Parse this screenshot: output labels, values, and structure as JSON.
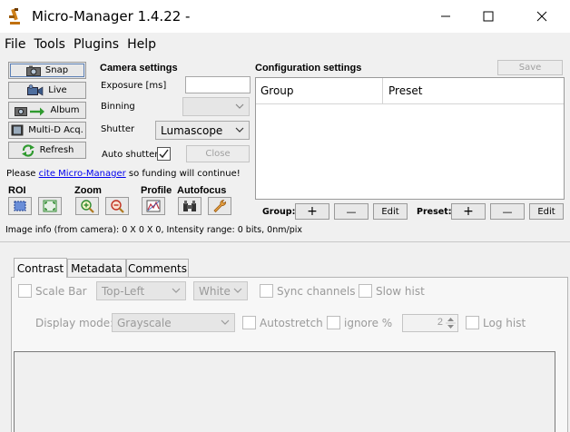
{
  "window": {
    "title": "Micro-Manager 1.4.22 -",
    "minimize_symbol": "—",
    "maximize_symbol": "☐",
    "close_symbol": "✕"
  },
  "menu": [
    "File",
    "Tools",
    "Plugins",
    "Help"
  ],
  "left_buttons": {
    "snap": "Snap",
    "live": "Live",
    "album": "Album",
    "multid": "Multi-D Acq.",
    "refresh": "Refresh"
  },
  "camera": {
    "title": "Camera settings",
    "exposure_label": "Exposure [ms]",
    "exposure_value": "",
    "binning_label": "Binning",
    "binning_value": "",
    "shutter_label": "Shutter",
    "shutter_value": "Lumascope",
    "auto_shutter_label": "Auto shutter",
    "auto_shutter_checked": true,
    "close_label": "Close"
  },
  "config": {
    "title": "Configuration settings",
    "save_label": "Save",
    "columns": [
      "Group",
      "Preset"
    ],
    "group_label": "Group:",
    "preset_label": "Preset:",
    "add_symbol": "+",
    "remove_symbol": "—",
    "edit_label": "Edit"
  },
  "cite": {
    "prefix": "Please ",
    "link": "cite Micro-Manager",
    "suffix": " so funding will continue!"
  },
  "tools": {
    "roi": "ROI",
    "zoom": "Zoom",
    "profile": "Profile",
    "autofocus": "Autofocus"
  },
  "image_info": "Image info (from camera): 0 X 0 X 0, Intensity range: 0 bits, 0nm/pix",
  "tabs": [
    "Contrast",
    "Metadata",
    "Comments"
  ],
  "contrast": {
    "scale_bar_label": "Scale Bar",
    "position_value": "Top-Left",
    "color_value": "White",
    "sync_channels_label": "Sync channels",
    "slow_hist_label": "Slow hist",
    "display_mode_label": "Display mode:",
    "display_mode_value": "Grayscale",
    "autostretch_label": "Autostretch",
    "ignore_label": "ignore %",
    "ignore_value": "2",
    "log_hist_label": "Log hist"
  },
  "colors": {
    "link": "#0000ee",
    "disabled_text": "#9a9a9a",
    "window_bg": "#f0f0f0"
  }
}
